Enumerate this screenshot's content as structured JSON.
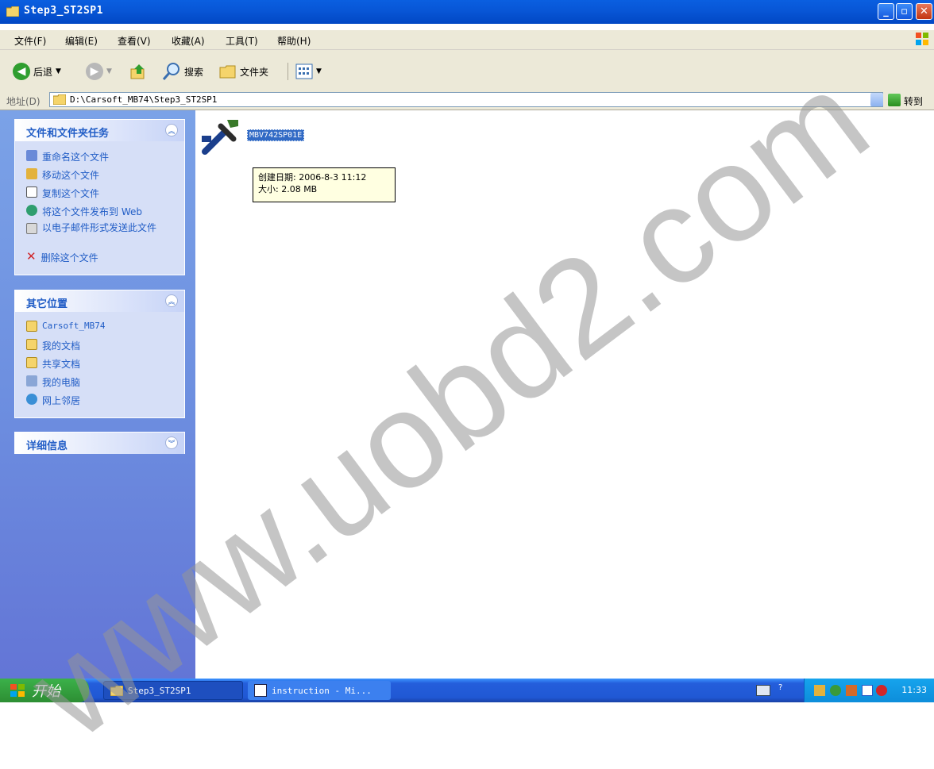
{
  "window": {
    "title": "Step3_ST2SP1"
  },
  "menu": [
    "文件(F)",
    "编辑(E)",
    "查看(V)",
    "收藏(A)",
    "工具(T)",
    "帮助(H)"
  ],
  "toolbar": {
    "back": "后退",
    "search": "搜索",
    "folders": "文件夹"
  },
  "address": {
    "label": "地址(D)",
    "path": "D:\\Carsoft_MB74\\Step3_ST2SP1",
    "go": "转到"
  },
  "tasks_panel": {
    "title": "文件和文件夹任务",
    "items": [
      "重命名这个文件",
      "移动这个文件",
      "复制这个文件",
      "将这个文件发布到 Web",
      "以电子邮件形式发送此文件",
      "删除这个文件"
    ]
  },
  "places_panel": {
    "title": "其它位置",
    "items": [
      "Carsoft_MB74",
      "我的文档",
      "共享文档",
      "我的电脑",
      "网上邻居"
    ]
  },
  "details_panel": {
    "title": "详细信息"
  },
  "file": {
    "name": "MBV742SP01E"
  },
  "tooltip": {
    "line1": "创建日期: 2006-8-3 11:12",
    "line2": "大小: 2.08 MB"
  },
  "taskbar": {
    "start": "开始",
    "buttons": [
      "Step3_ST2SP1",
      "instruction - Mi..."
    ],
    "clock": "11:33"
  },
  "watermark": "www.uobd2.com",
  "colors": {
    "title_bar": "#0856d6",
    "left_pane": "#6d8fe0",
    "selection": "#316ac5"
  }
}
